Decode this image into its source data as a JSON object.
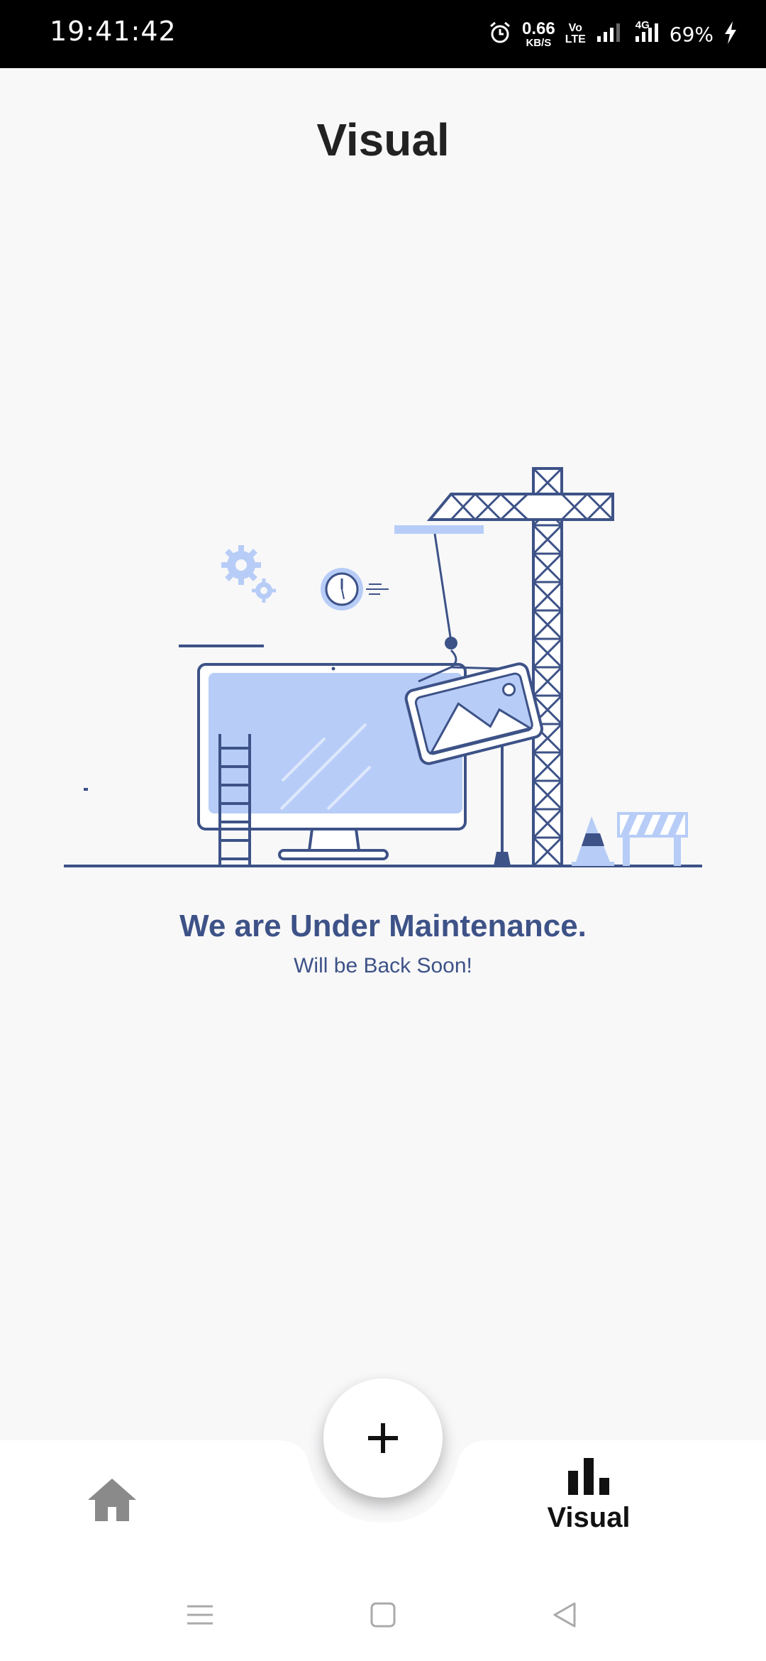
{
  "status_bar": {
    "time": "19:41:42",
    "net_speed_value": "0.66",
    "net_speed_unit": "KB/S",
    "volte_top": "Vo",
    "volte_bottom": "LTE",
    "network_type": "4G",
    "battery": "69%"
  },
  "header": {
    "title": "Visual"
  },
  "maintenance": {
    "title": "We are Under Maintenance.",
    "subtitle": "Will be Back Soon!"
  },
  "bottom_nav": {
    "home_icon": "home-icon",
    "fab_icon": "plus-icon",
    "visual_icon": "bar-chart-icon",
    "visual_label": "Visual"
  },
  "colors": {
    "accent_dark": "#3d5287",
    "accent_light": "#b7cdf7",
    "background": "#f8f8f9"
  }
}
